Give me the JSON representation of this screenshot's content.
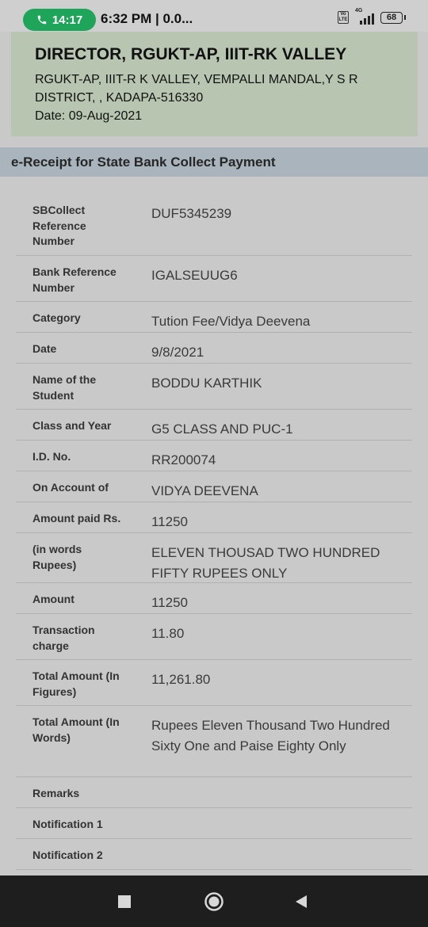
{
  "status_bar": {
    "call_time": "14:17",
    "time_text": "6:32 PM | 0.0...",
    "volte": "Vo LTE",
    "network": "4G",
    "battery": "68"
  },
  "header": {
    "title": "DIRECTOR, RGUKT-AP, IIIT-RK VALLEY",
    "address_line1": "RGUKT-AP, IIIT-R K VALLEY, VEMPALLI MANDAL,Y S R",
    "address_line2": "DISTRICT, , KADAPA-516330",
    "date": "Date: 09-Aug-2021"
  },
  "section_title": "e-Receipt for State Bank Collect Payment",
  "receipt_rows": [
    {
      "label": "SBCollect Reference Number",
      "value": "DUF5345239"
    },
    {
      "label": "Bank Reference Number",
      "value": "IGALSEUUG6"
    },
    {
      "label": "Category",
      "value": "Tution Fee/Vidya Deevena"
    },
    {
      "label": "Date",
      "value": "9/8/2021"
    },
    {
      "label": "Name of the Student",
      "value": "BODDU KARTHIK"
    },
    {
      "label": "Class and Year",
      "value": "G5 CLASS AND PUC-1"
    },
    {
      "label": "I.D. No.",
      "value": "RR200074"
    },
    {
      "label": "On Account of",
      "value": "VIDYA DEEVENA"
    },
    {
      "label": "Amount paid Rs.",
      "value": "11250"
    },
    {
      "label": "(in words Rupees)",
      "value": "ELEVEN THOUSAD TWO HUNDRED FIFTY RUPEES ONLY"
    },
    {
      "label": "Amount",
      "value": "11250"
    },
    {
      "label": "Transaction charge",
      "value": "11.80"
    },
    {
      "label": "Total Amount (In Figures)",
      "value": "11,261.80"
    },
    {
      "label": "Total Amount (In Words)",
      "value": "Rupees Eleven Thousand Two Hundred Sixty One and Paise Eighty Only"
    },
    {
      "label": "Remarks",
      "value": ""
    },
    {
      "label": "Notification 1",
      "value": ""
    },
    {
      "label": "Notification 2",
      "value": ""
    }
  ],
  "nav": {
    "icons": [
      "recents-square-icon",
      "home-circle-icon",
      "back-triangle-icon"
    ]
  }
}
